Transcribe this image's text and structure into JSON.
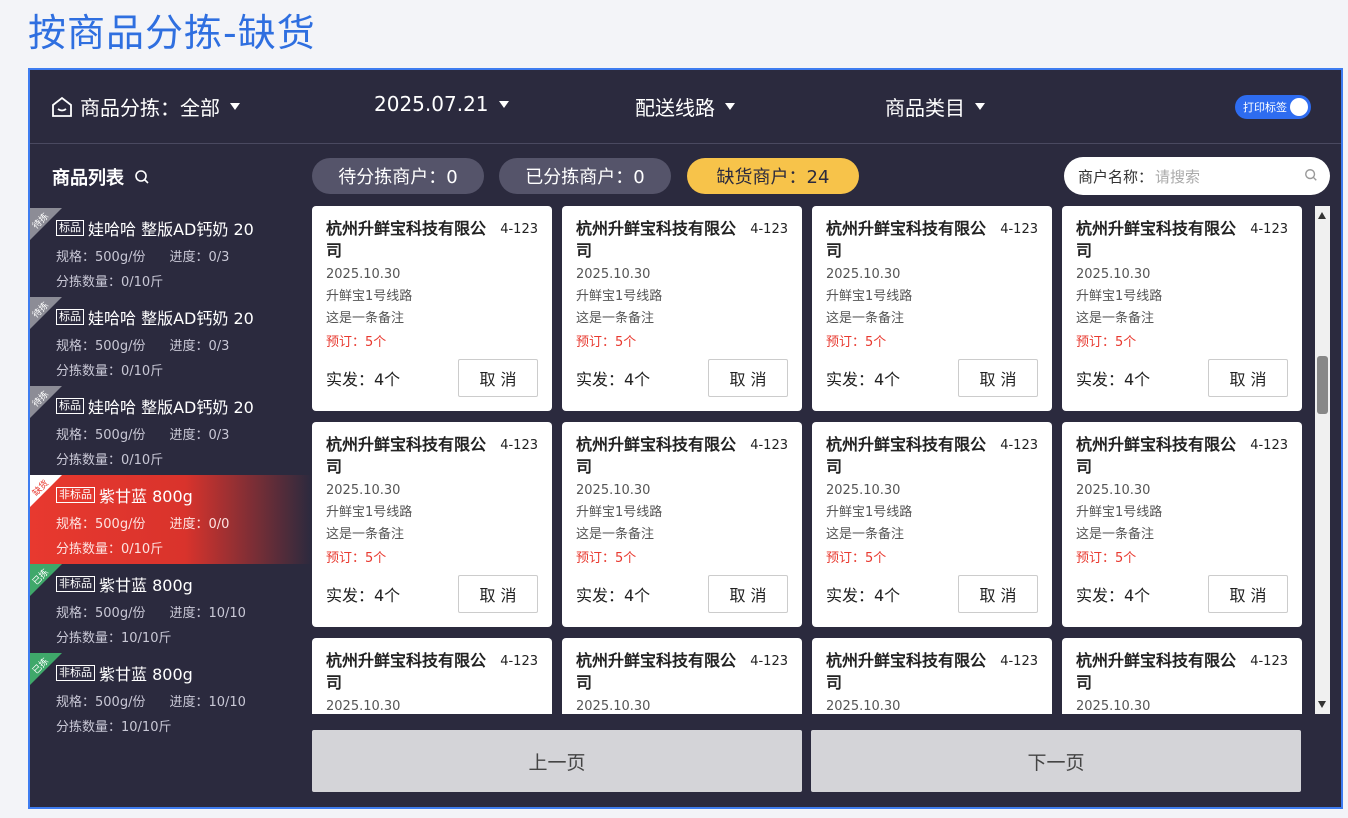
{
  "page_title": "按商品分拣-缺货",
  "topbar": {
    "sort_filter": "商品分拣：全部",
    "date": "2025.07.21",
    "route": "配送线路",
    "category": "商品类目",
    "print_toggle_label": "打印标签",
    "print_toggle_on": true
  },
  "sidebar": {
    "title": "商品列表",
    "items": [
      {
        "status": "待拣",
        "tag": "标品",
        "name": "娃哈哈 整版AD钙奶 20",
        "spec": "规格：500g/份",
        "progress": "进度：0/3",
        "qty": "分拣数量：0/10斤",
        "active": false
      },
      {
        "status": "待拣",
        "tag": "标品",
        "name": "娃哈哈 整版AD钙奶 20",
        "spec": "规格：500g/份",
        "progress": "进度：0/3",
        "qty": "分拣数量：0/10斤",
        "active": false
      },
      {
        "status": "待拣",
        "tag": "标品",
        "name": "娃哈哈 整版AD钙奶 20",
        "spec": "规格：500g/份",
        "progress": "进度：0/3",
        "qty": "分拣数量：0/10斤",
        "active": false
      },
      {
        "status": "缺货",
        "tag": "非标品",
        "name": "紫甘蓝 800g",
        "spec": "规格：500g/份",
        "progress": "进度：0/0",
        "qty": "分拣数量：0/10斤",
        "active": true
      },
      {
        "status": "已拣",
        "tag": "非标品",
        "name": "紫甘蓝 800g",
        "spec": "规格：500g/份",
        "progress": "进度：10/10",
        "qty": "分拣数量：10/10斤",
        "active": false
      },
      {
        "status": "已拣",
        "tag": "非标品",
        "name": "紫甘蓝 800g",
        "spec": "规格：500g/份",
        "progress": "进度：10/10",
        "qty": "分拣数量：10/10斤",
        "active": false
      }
    ]
  },
  "filters": {
    "pending": "待分拣商户：0",
    "done": "已分拣商户：0",
    "short": "缺货商户：24"
  },
  "search": {
    "label": "商户名称：",
    "placeholder": "请搜索"
  },
  "card": {
    "company": "杭州升鲜宝科技有限公司",
    "code": "4-123",
    "date": "2025.10.30",
    "route": "升鲜宝1号线路",
    "note": "这是一条备注",
    "order": "预订：5个",
    "shipped": "实发：4个",
    "cancel": "取 消"
  },
  "pager": {
    "prev": "上一页",
    "next": "下一页"
  },
  "colors": {
    "accent": "#2f6fe0",
    "bg": "#2b2a3e",
    "short": "#f7c34a",
    "danger": "#e8392f"
  }
}
